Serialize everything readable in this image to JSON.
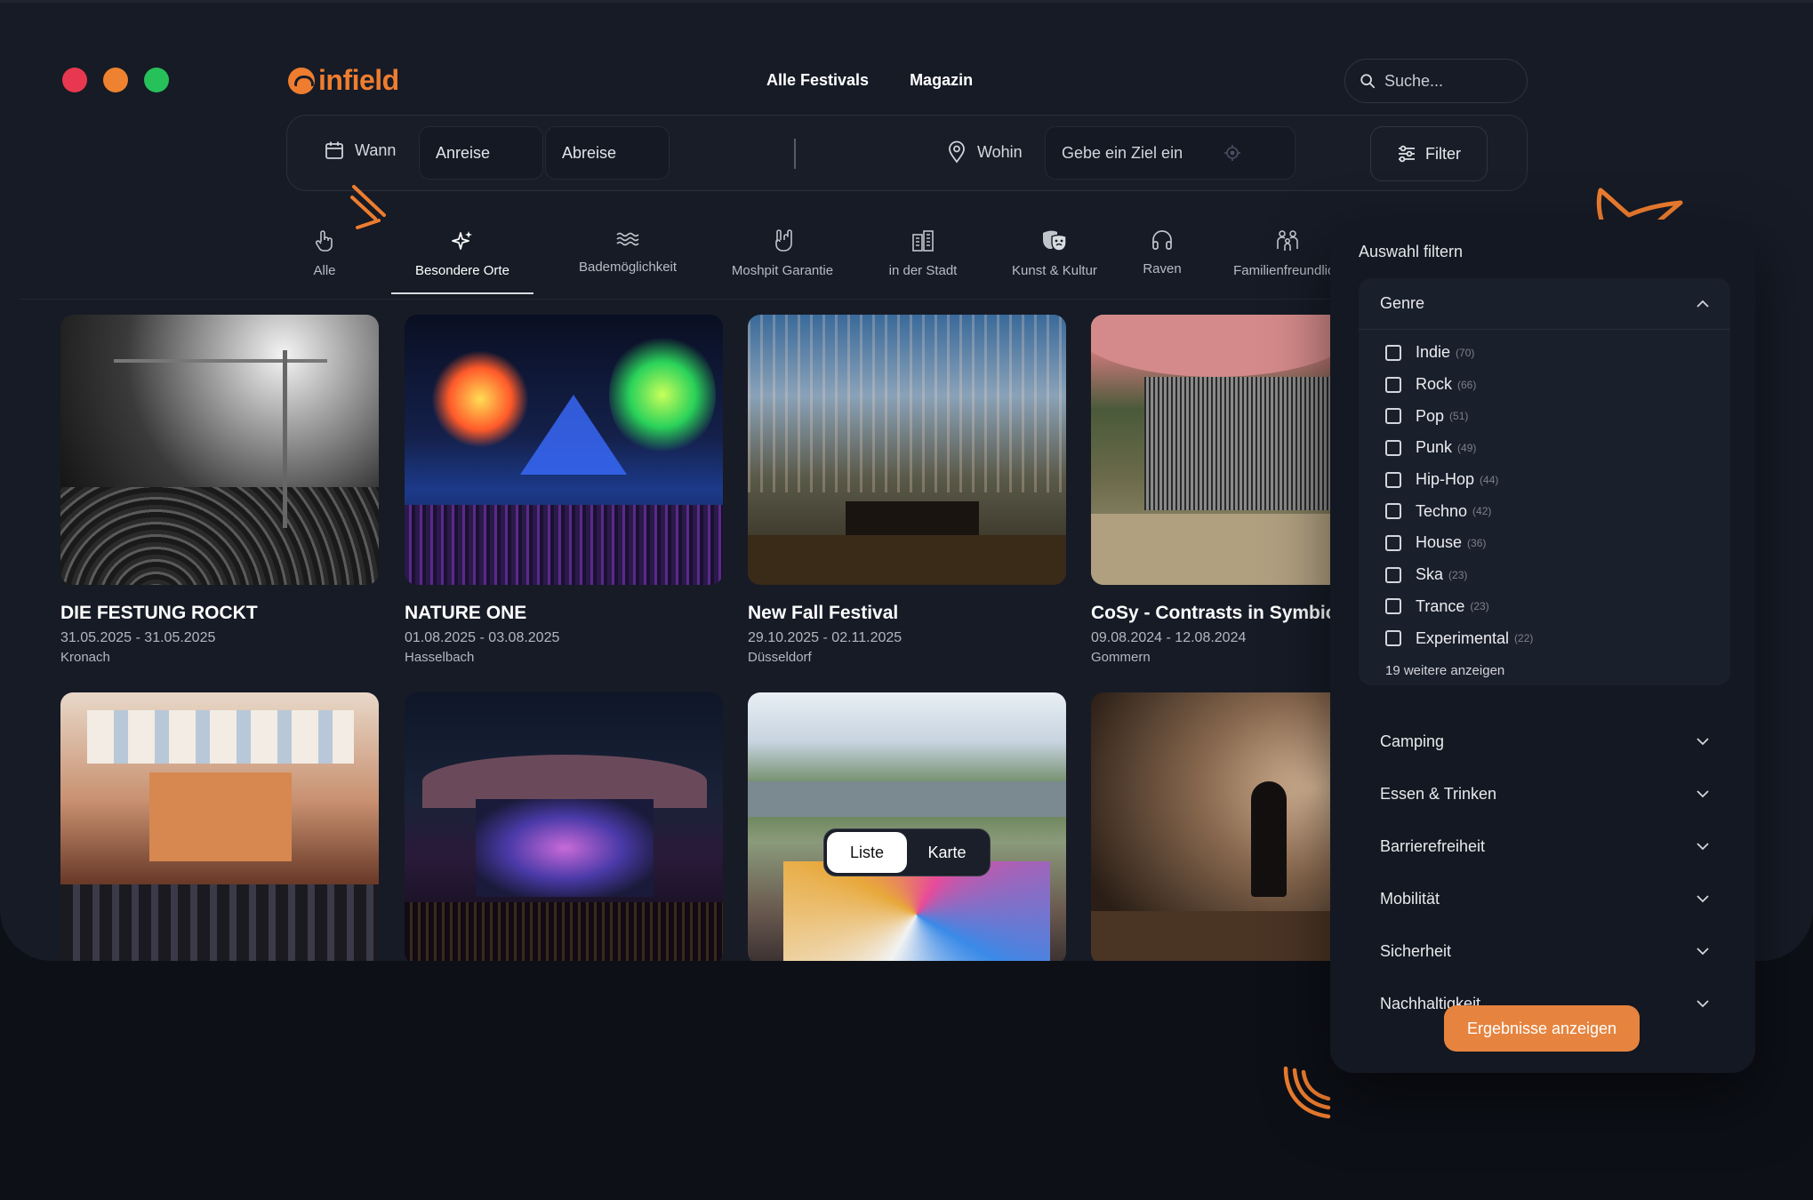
{
  "window": {
    "dots": [
      "#e8384f",
      "#ef8230",
      "#27c159"
    ]
  },
  "brand": {
    "name": "infield",
    "color": "#ee7d2f"
  },
  "nav": {
    "items": [
      "Alle Festivals",
      "Magazin"
    ]
  },
  "search": {
    "placeholder": "Suche..."
  },
  "searchbar": {
    "when_label": "Wann",
    "arrival": "Anreise",
    "departure": "Abreise",
    "where_label": "Wohin",
    "destination_placeholder": "Gebe ein Ziel ein",
    "filter_label": "Filter"
  },
  "categories": [
    {
      "label": "Alle",
      "icon": "hand-pointer-icon"
    },
    {
      "label": "Besondere Orte",
      "icon": "sparkles-icon",
      "active": true
    },
    {
      "label": "Bademöglichkeit",
      "icon": "waves-icon"
    },
    {
      "label": "Moshpit Garantie",
      "icon": "rock-hand-icon"
    },
    {
      "label": "in der Stadt",
      "icon": "buildings-icon"
    },
    {
      "label": "Kunst & Kultur",
      "icon": "theater-masks-icon"
    },
    {
      "label": "Raven",
      "icon": "headphones-icon"
    },
    {
      "label": "Familienfreundlich",
      "icon": "family-icon"
    }
  ],
  "festivals": [
    {
      "title": "DIE FESTUNG ROCKT",
      "date": "31.05.2025 - 31.05.2025",
      "location": "Kronach"
    },
    {
      "title": "NATURE ONE",
      "date": "01.08.2025 - 03.08.2025",
      "location": "Hasselbach"
    },
    {
      "title": "New Fall Festival",
      "date": "29.10.2025 - 02.11.2025",
      "location": "Düsseldorf"
    },
    {
      "title": "CoSy - Contrasts in Symbiosis",
      "date": "09.08.2024 - 12.08.2024",
      "location": "Gommern"
    }
  ],
  "view_toggle": {
    "list": "Liste",
    "map": "Karte"
  },
  "filter_panel": {
    "title": "Auswahl filtern",
    "genre_label": "Genre",
    "genres": [
      {
        "name": "Indie",
        "count": "(70)"
      },
      {
        "name": "Rock",
        "count": "(66)"
      },
      {
        "name": "Pop",
        "count": "(51)"
      },
      {
        "name": "Punk",
        "count": "(49)"
      },
      {
        "name": "Hip-Hop",
        "count": "(44)"
      },
      {
        "name": "Techno",
        "count": "(42)"
      },
      {
        "name": "House",
        "count": "(36)"
      },
      {
        "name": "Ska",
        "count": "(23)"
      },
      {
        "name": "Trance",
        "count": "(23)"
      },
      {
        "name": "Experimental",
        "count": "(22)"
      }
    ],
    "more_label": "19 weitere anzeigen",
    "sections": [
      "Camping",
      "Essen & Trinken",
      "Barrierefreiheit",
      "Mobilität",
      "Sicherheit",
      "Nachhaltigkeit"
    ],
    "cta": "Ergebnisse anzeigen",
    "cta_color": "#e6843f"
  }
}
